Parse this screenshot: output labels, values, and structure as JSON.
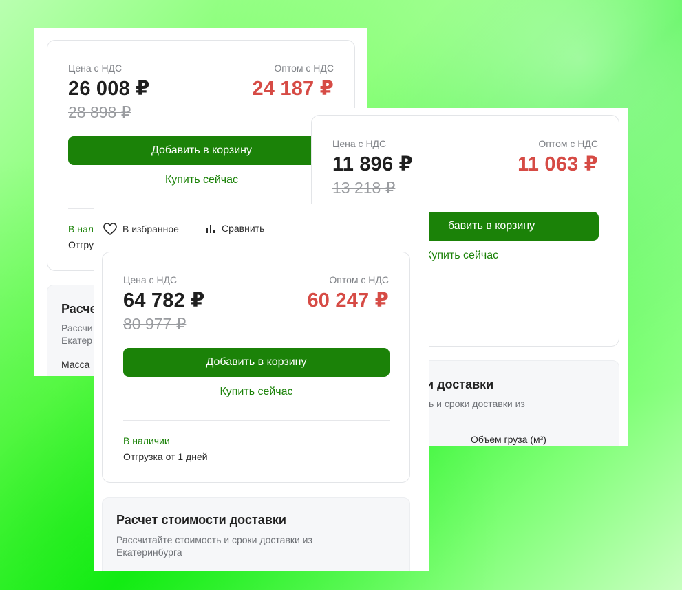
{
  "labels": {
    "price_label": "Цена с НДС",
    "wholesale_label": "Оптом с НДС",
    "add_to_cart": "Добавить в корзину",
    "buy_now": "Купить сейчас",
    "in_stock": "В наличии",
    "shipping": "Отгрузка от 1 дней",
    "favorite": "В избранное",
    "compare": "Сравнить",
    "delivery_title": "Расчет стоимости доставки",
    "delivery_subtitle": "Рассчитайте стоимость и сроки доставки из Екатеринбурга",
    "mass_label": "Масса",
    "volume_label": "Объем груза (м³)"
  },
  "cards": [
    {
      "price": "26 008 ₽",
      "old_price": "28 898 ₽",
      "wholesale_price": "24 187 ₽",
      "stock_partial": "В нали",
      "ship_partial": "Отгру",
      "delivery_title_partial": "Расче",
      "delivery_sub_line1_partial": "Рассчи",
      "delivery_sub_line2_partial": "Екатер"
    },
    {
      "price": "11 896 ₽",
      "old_price": "13 218 ₽",
      "wholesale_price": "11 063 ₽",
      "add_to_cart_partial": "бавить в корзину",
      "buy_now_partial": "Купить сейчас",
      "delivery_title_partial": "и доставки",
      "delivery_sub_partial": "ь и сроки доставки из"
    },
    {
      "price": "64 782 ₽",
      "old_price": "80 977 ₽",
      "wholesale_price": "60 247 ₽"
    }
  ],
  "colors": {
    "accent_green": "#1b8208",
    "wholesale_red": "#d64b45",
    "background_green": "#19f21a"
  },
  "icons": [
    "heart-icon",
    "bar-chart-icon"
  ]
}
